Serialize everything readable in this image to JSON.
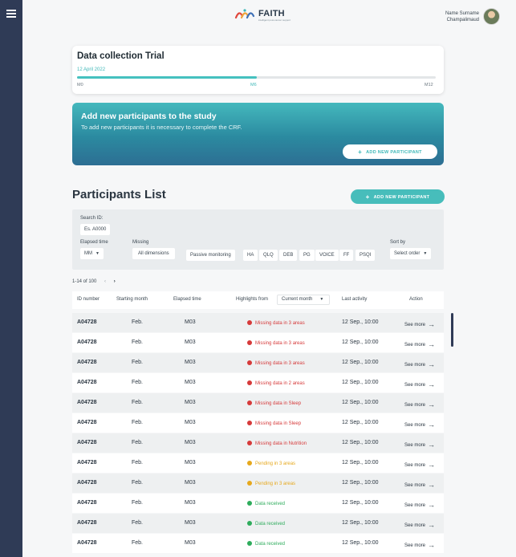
{
  "brand": {
    "name": "FAITH",
    "tagline": "intelligent post-cancer support"
  },
  "user": {
    "name": "Name Surname",
    "org": "Champalimaud"
  },
  "trial": {
    "title": "Data collection Trial",
    "date": "12 April 2022",
    "progress": 0.5,
    "milestones": [
      "M0",
      "M6",
      "M12"
    ]
  },
  "banner": {
    "title": "Add new participants to the study",
    "subtitle": "To add new participants it is necessary to complete the CRF.",
    "button": "ADD NEW PARTICIPANT"
  },
  "list": {
    "title": "Participants List",
    "button": "ADD NEW PARTICIPANT"
  },
  "filters": {
    "search_label": "Search ID:",
    "search_placeholder": "Es. A0000",
    "elapsed_label": "Elapsed time",
    "elapsed_value": "MM",
    "missing_label": "Missing",
    "missing_options": [
      "All dimensions",
      "Passive monitoring",
      "HA",
      "QLQ",
      "DEB",
      "PG",
      "VOICE",
      "FF",
      "PSQI"
    ],
    "sort_label": "Sort by",
    "sort_value": "Select order"
  },
  "pagination": {
    "text": "1-14 of 100"
  },
  "table": {
    "headers": [
      "ID number",
      "Starting month",
      "Elapsed time",
      "Highlights from",
      "Last activity",
      "Action"
    ],
    "highlights_select": "Current month",
    "rows": [
      {
        "id": "A04728",
        "month": "Feb.",
        "elapsed": "M03",
        "status": "red",
        "highlight": "Missing data in 3 areas",
        "activity": "12 Sep., 10:00",
        "action": "See more"
      },
      {
        "id": "A04728",
        "month": "Feb.",
        "elapsed": "M03",
        "status": "red",
        "highlight": "Missing data in 3 areas",
        "activity": "12 Sep., 10:00",
        "action": "See more"
      },
      {
        "id": "A04728",
        "month": "Feb.",
        "elapsed": "M03",
        "status": "red",
        "highlight": "Missing data in 3 areas",
        "activity": "12 Sep., 10:00",
        "action": "See more"
      },
      {
        "id": "A04728",
        "month": "Feb.",
        "elapsed": "M03",
        "status": "red",
        "highlight": "Missing data in 2 areas",
        "activity": "12 Sep., 10:00",
        "action": "See more"
      },
      {
        "id": "A04728",
        "month": "Feb.",
        "elapsed": "M03",
        "status": "red",
        "highlight": "Missing data in Sleep",
        "activity": "12 Sep., 10:00",
        "action": "See more"
      },
      {
        "id": "A04728",
        "month": "Feb.",
        "elapsed": "M03",
        "status": "red",
        "highlight": "Missing data in Sleep",
        "activity": "12 Sep., 10:00",
        "action": "See more"
      },
      {
        "id": "A04728",
        "month": "Feb.",
        "elapsed": "M03",
        "status": "red",
        "highlight": "Missing data in Nutrition",
        "activity": "12 Sep., 10:00",
        "action": "See more"
      },
      {
        "id": "A04728",
        "month": "Feb.",
        "elapsed": "M03",
        "status": "amber",
        "highlight": "Pending in 3 areas",
        "activity": "12 Sep., 10:00",
        "action": "See more"
      },
      {
        "id": "A04728",
        "month": "Feb.",
        "elapsed": "M03",
        "status": "amber",
        "highlight": "Pending in 3 areas",
        "activity": "12 Sep., 10:00",
        "action": "See more"
      },
      {
        "id": "A04728",
        "month": "Feb.",
        "elapsed": "M03",
        "status": "green",
        "highlight": "Data received",
        "activity": "12 Sep., 10:00",
        "action": "See more"
      },
      {
        "id": "A04728",
        "month": "Feb.",
        "elapsed": "M03",
        "status": "green",
        "highlight": "Data received",
        "activity": "12 Sep., 10:00",
        "action": "See more"
      },
      {
        "id": "A04728",
        "month": "Feb.",
        "elapsed": "M03",
        "status": "green",
        "highlight": "Data received",
        "activity": "12 Sep., 10:00",
        "action": "See more"
      }
    ]
  },
  "colors": {
    "accent": "#45c1bf",
    "sidebar": "#2f3b56",
    "status_red": "#d63a3a",
    "status_amber": "#e6a81c",
    "status_green": "#2eac5c"
  }
}
